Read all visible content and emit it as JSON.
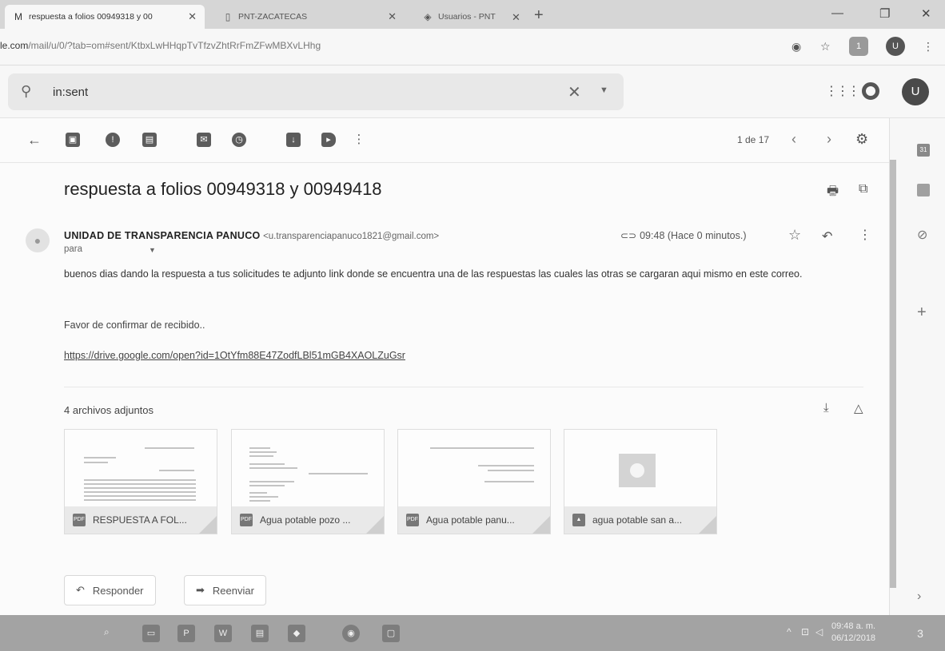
{
  "browser": {
    "tabs": [
      {
        "title": "respuesta a folios 00949318 y 00",
        "icon": "gmail-icon",
        "active": true
      },
      {
        "title": "PNT-ZACATECAS",
        "icon": "page-icon",
        "active": false
      },
      {
        "title": "Usuarios - PNT",
        "icon": "pnt-logo-icon",
        "active": false
      }
    ],
    "url_host": "le.com",
    "url_path": "/mail/u/0/?tab=om#sent/KtbxLwHHqpTvTfzvZhtRrFmZFwMBXvLHhg",
    "extension_badge": "1",
    "profile_initial": "U"
  },
  "gmail": {
    "search": {
      "value": "in:sent"
    },
    "avatar_initial": "U",
    "toolbar": {
      "pager": "1 de 17"
    },
    "email": {
      "subject": "respuesta a folios 00949318 y 00949418",
      "sender_name": "UNIDAD DE TRANSPARENCIA PANUCO",
      "sender_email": "<u.transparenciapanuco1821@gmail.com>",
      "to_label": "para",
      "time": "09:48 (Hace 0 minutos.)",
      "body": "buenos dias dando la respuesta a tus solicitudes te adjunto link donde se encuentra una de las respuestas las cuales las otras se cargaran aqui mismo en este correo.",
      "confirm": "Favor de confirmar de recibido..",
      "link": "https://drive.google.com/open?id=1OtYfm88E47ZodfLBl51mGB4XAOLZuGsr"
    },
    "attachments": {
      "header": "4 archivos adjuntos",
      "items": [
        {
          "name": "RESPUESTA A FOL...",
          "type": "pdf"
        },
        {
          "name": "Agua potable pozo ...",
          "type": "pdf"
        },
        {
          "name": "Agua potable panu...",
          "type": "pdf"
        },
        {
          "name": "agua potable san a...",
          "type": "image"
        }
      ]
    },
    "actions": {
      "reply": "Responder",
      "forward": "Reenviar"
    }
  },
  "taskbar": {
    "time": "09:48 a. m.",
    "date": "06/12/2018",
    "notification_count": "3"
  }
}
